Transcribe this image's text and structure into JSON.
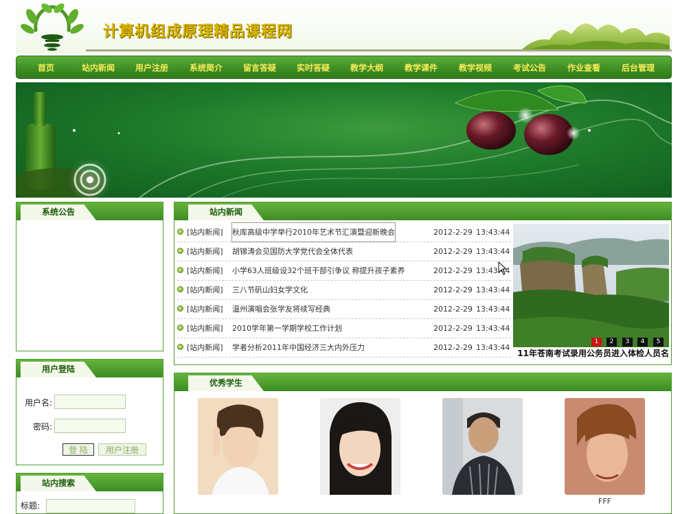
{
  "header": {
    "title": "计算机组成原理精品课程网"
  },
  "nav": {
    "items": [
      "首页",
      "站内新闻",
      "用户注册",
      "系统简介",
      "留言答疑",
      "实时答疑",
      "教学大纲",
      "教学课件",
      "教学视频",
      "考试公告",
      "作业查看",
      "后台管理"
    ]
  },
  "announcement": {
    "title": "系统公告"
  },
  "login": {
    "title": "用户登陆",
    "username_label": "用户名:",
    "password_label": "密码:",
    "username_value": "",
    "password_value": "",
    "login_button": "登 陆",
    "register_button": "用户注册"
  },
  "search": {
    "title": "站内搜索",
    "label": "标题:"
  },
  "news": {
    "title": "站内新闻",
    "items": [
      {
        "category": "[站内新闻]",
        "title": "秋库高级中学举行2010年艺术节汇演暨迎新晚会",
        "date": "2012-2-29",
        "time": "13:43:44"
      },
      {
        "category": "[站内新闻]",
        "title": "胡锦涛会见国防大学党代会全体代表",
        "date": "2012-2-29",
        "time": "13:43:44"
      },
      {
        "category": "[站内新闻]",
        "title": "小学63人班级设32个班干部引争议 称提升孩子素养",
        "date": "2012-2-29",
        "time": "13:43:44"
      },
      {
        "category": "[站内新闻]",
        "title": "三八节矾山妇女学文化",
        "date": "2012-2-29",
        "time": "13:43:44"
      },
      {
        "category": "[站内新闻]",
        "title": "温州演唱会张学友将续写经典",
        "date": "2012-2-29",
        "time": "13:43:44"
      },
      {
        "category": "[站内新闻]",
        "title": "2010学年第一学期学校工作计划",
        "date": "2012-2-29",
        "time": "13:43:44"
      },
      {
        "category": "[站内新闻]",
        "title": "学者分析2011年中国经济三大内外压力",
        "date": "2012-2-29",
        "time": "13:43:44"
      }
    ],
    "slideshow": {
      "caption": "11年苍南考试录用公务员进入体检人员名",
      "pages": [
        "1",
        "2",
        "3",
        "4",
        "5"
      ],
      "active_page": "1"
    }
  },
  "students": {
    "title": "优秀学生",
    "names": [
      "",
      "",
      "",
      "FFF"
    ]
  },
  "colors": {
    "nav_text": "#f6ec5a",
    "title_gold": "#d8b400",
    "panel_green": "#4d9a2e"
  }
}
